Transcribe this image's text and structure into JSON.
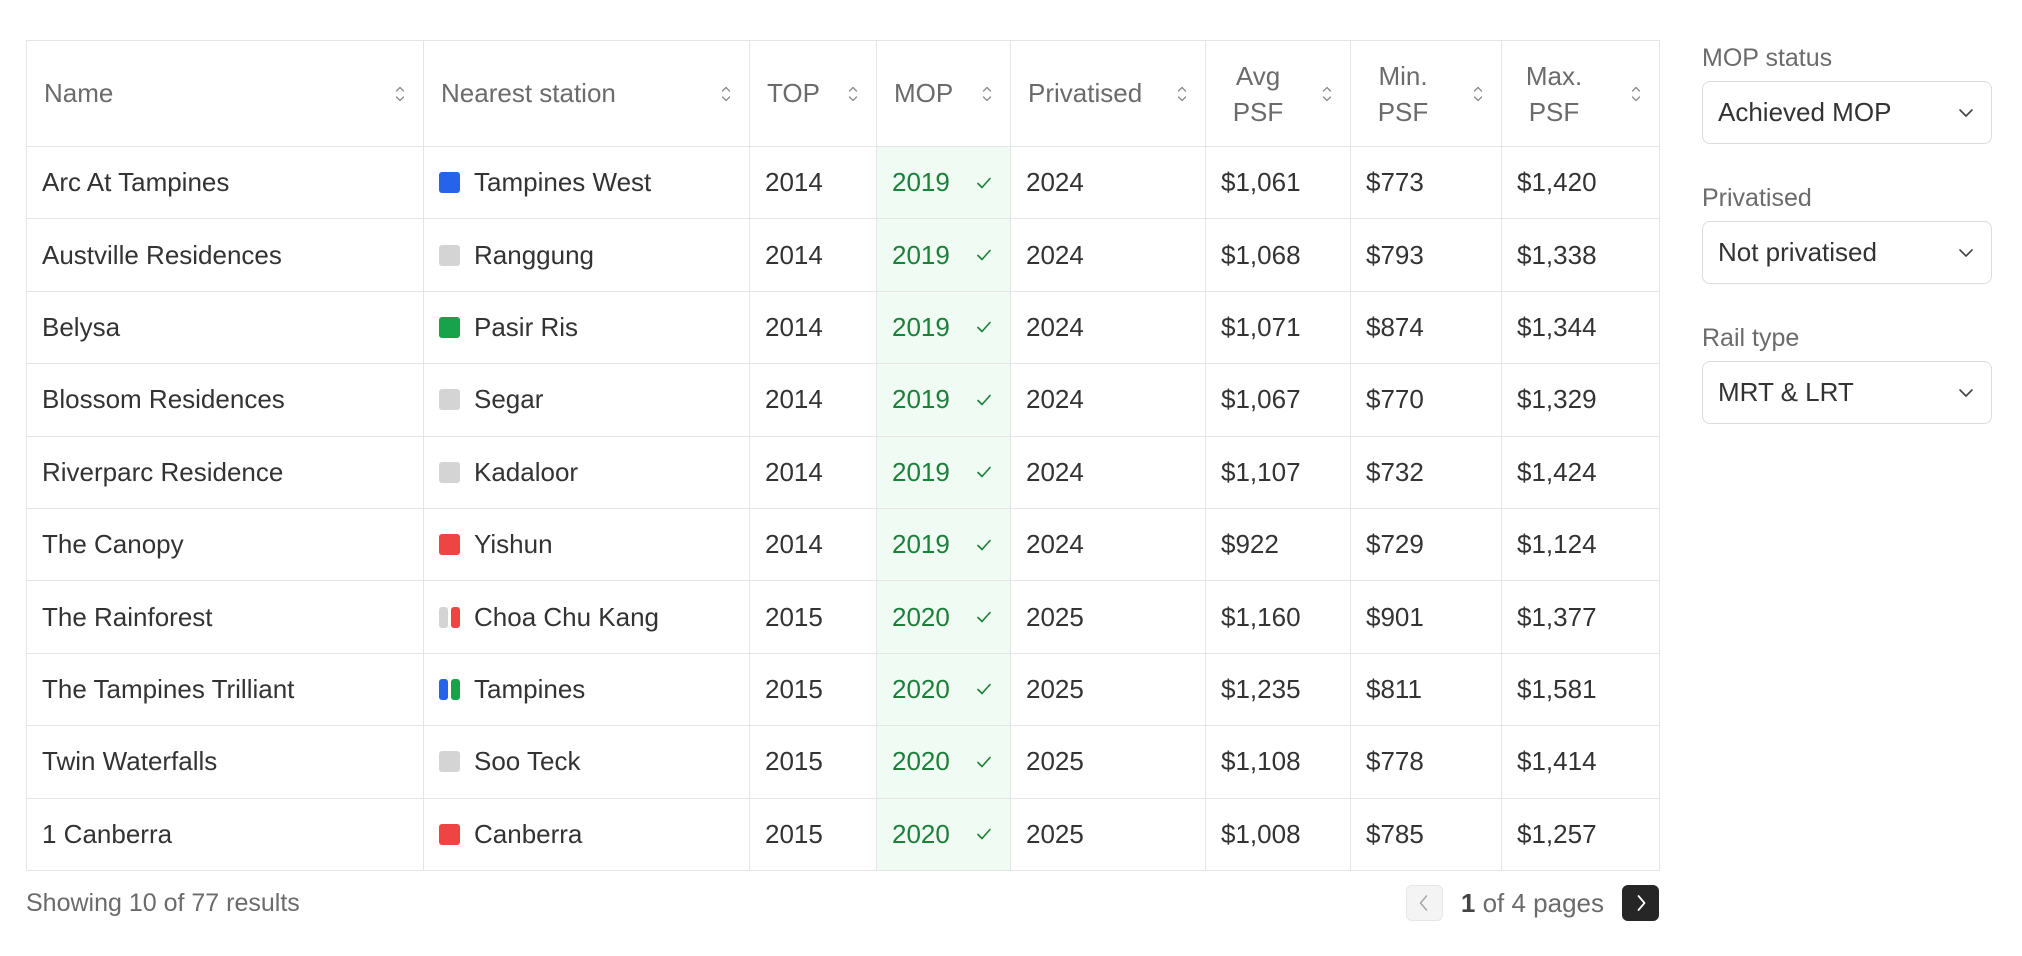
{
  "table": {
    "columns": [
      {
        "key": "name",
        "label": "Name",
        "sortable": true
      },
      {
        "key": "station",
        "label": "Nearest station",
        "sortable": true
      },
      {
        "key": "top",
        "label": "TOP",
        "sortable": true
      },
      {
        "key": "mop",
        "label": "MOP",
        "sortable": true
      },
      {
        "key": "privatised",
        "label": "Privatised",
        "sortable": true
      },
      {
        "key": "avg_psf",
        "label": "Avg PSF",
        "sortable": true
      },
      {
        "key": "min_psf",
        "label": "Min. PSF",
        "sortable": true
      },
      {
        "key": "max_psf",
        "label": "Max. PSF",
        "sortable": true
      }
    ],
    "rows": [
      {
        "name": "Arc At Tampines",
        "station": "Tampines West",
        "line_colors": [
          "#2563eb"
        ],
        "top": "2014",
        "mop": "2019",
        "mop_achieved": true,
        "privatised": "2024",
        "avg_psf": "$1,061",
        "min_psf": "$773",
        "max_psf": "$1,420"
      },
      {
        "name": "Austville Residences",
        "station": "Ranggung",
        "line_colors": [
          "#d4d4d4"
        ],
        "top": "2014",
        "mop": "2019",
        "mop_achieved": true,
        "privatised": "2024",
        "avg_psf": "$1,068",
        "min_psf": "$793",
        "max_psf": "$1,338"
      },
      {
        "name": "Belysa",
        "station": "Pasir Ris",
        "line_colors": [
          "#16a34a"
        ],
        "top": "2014",
        "mop": "2019",
        "mop_achieved": true,
        "privatised": "2024",
        "avg_psf": "$1,071",
        "min_psf": "$874",
        "max_psf": "$1,344"
      },
      {
        "name": "Blossom Residences",
        "station": "Segar",
        "line_colors": [
          "#d4d4d4"
        ],
        "top": "2014",
        "mop": "2019",
        "mop_achieved": true,
        "privatised": "2024",
        "avg_psf": "$1,067",
        "min_psf": "$770",
        "max_psf": "$1,329"
      },
      {
        "name": "Riverparc Residence",
        "station": "Kadaloor",
        "line_colors": [
          "#d4d4d4"
        ],
        "top": "2014",
        "mop": "2019",
        "mop_achieved": true,
        "privatised": "2024",
        "avg_psf": "$1,107",
        "min_psf": "$732",
        "max_psf": "$1,424"
      },
      {
        "name": "The Canopy",
        "station": "Yishun",
        "line_colors": [
          "#ef4444"
        ],
        "top": "2014",
        "mop": "2019",
        "mop_achieved": true,
        "privatised": "2024",
        "avg_psf": "$922",
        "min_psf": "$729",
        "max_psf": "$1,124"
      },
      {
        "name": "The Rainforest",
        "station": "Choa Chu Kang",
        "line_colors": [
          "#d4d4d4",
          "#ef4444"
        ],
        "top": "2015",
        "mop": "2020",
        "mop_achieved": true,
        "privatised": "2025",
        "avg_psf": "$1,160",
        "min_psf": "$901",
        "max_psf": "$1,377"
      },
      {
        "name": "The Tampines Trilliant",
        "station": "Tampines",
        "line_colors": [
          "#2563eb",
          "#16a34a"
        ],
        "top": "2015",
        "mop": "2020",
        "mop_achieved": true,
        "privatised": "2025",
        "avg_psf": "$1,235",
        "min_psf": "$811",
        "max_psf": "$1,581"
      },
      {
        "name": "Twin Waterfalls",
        "station": "Soo Teck",
        "line_colors": [
          "#d4d4d4"
        ],
        "top": "2015",
        "mop": "2020",
        "mop_achieved": true,
        "privatised": "2025",
        "avg_psf": "$1,108",
        "min_psf": "$778",
        "max_psf": "$1,414"
      },
      {
        "name": "1 Canberra",
        "station": "Canberra",
        "line_colors": [
          "#ef4444"
        ],
        "top": "2015",
        "mop": "2020",
        "mop_achieved": true,
        "privatised": "2025",
        "avg_psf": "$1,008",
        "min_psf": "$785",
        "max_psf": "$1,257"
      }
    ]
  },
  "footer": {
    "results_text": "Showing 10 of 77 results",
    "current_page": "1",
    "page_suffix": " of 4 pages",
    "prev_icon": "chevron-left-icon",
    "next_icon": "chevron-right-icon"
  },
  "filters": [
    {
      "label": "MOP status",
      "value": "Achieved MOP"
    },
    {
      "label": "Privatised",
      "value": "Not privatised"
    },
    {
      "label": "Rail type",
      "value": "MRT & LRT"
    }
  ],
  "colors": {
    "mop_bg": "#f0fbf3",
    "mop_text": "#1c7f3a",
    "ew_line": "#16a34a",
    "dt_line": "#2563eb",
    "ns_line": "#ef4444",
    "lrt": "#d4d4d4",
    "next_button": "#262626"
  }
}
